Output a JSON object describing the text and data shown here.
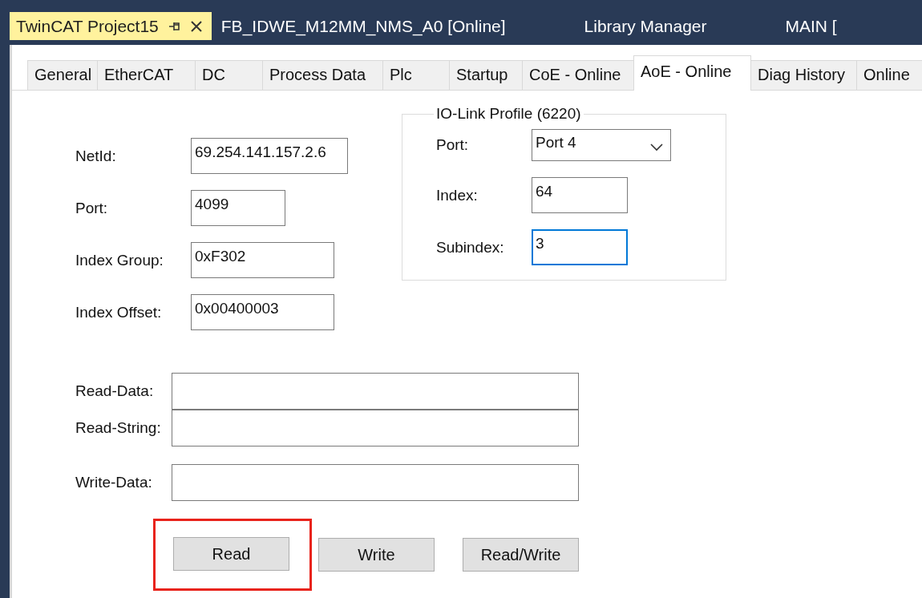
{
  "document_tabs": [
    {
      "label": "TwinCAT Project15",
      "selected": true
    },
    {
      "label": "FB_IDWE_M12MM_NMS_A0 [Online]",
      "selected": false
    },
    {
      "label": "Library Manager",
      "selected": false
    },
    {
      "label": "MAIN [",
      "selected": false
    }
  ],
  "tabs": [
    {
      "label": "General",
      "selected": false
    },
    {
      "label": "EtherCAT",
      "selected": false
    },
    {
      "label": "DC",
      "selected": false
    },
    {
      "label": "Process Data",
      "selected": false
    },
    {
      "label": "Plc",
      "selected": false
    },
    {
      "label": "Startup",
      "selected": false
    },
    {
      "label": "CoE - Online",
      "selected": false
    },
    {
      "label": "AoE - Online",
      "selected": true
    },
    {
      "label": "Diag History",
      "selected": false
    },
    {
      "label": "Online",
      "selected": false
    }
  ],
  "connection_fields": [
    {
      "label": "NetId:",
      "value": "69.254.141.157.2.6"
    },
    {
      "label": "Port:",
      "value": "4099"
    },
    {
      "label": "Index Group:",
      "value": "0xF302"
    },
    {
      "label": "Index Offset:",
      "value": "0x00400003"
    }
  ],
  "io_link_profile": {
    "title": "IO-Link Profile (6220)",
    "fields": [
      {
        "kind": "dropdown",
        "label": "Port:",
        "value": "Port 4",
        "focused": false
      },
      {
        "kind": "text",
        "label": "Index:",
        "value": "64",
        "focused": false
      },
      {
        "kind": "text",
        "label": "Subindex:",
        "value": "3",
        "focused": true
      }
    ]
  },
  "data_fields": [
    {
      "label": "Read-Data:"
    },
    {
      "label": "Read-String:"
    },
    {
      "label": "Write-Data:"
    }
  ],
  "buttons": [
    {
      "label": "Read",
      "highlighted": true
    },
    {
      "label": "Write",
      "highlighted": false
    },
    {
      "label": "Read/Write",
      "highlighted": false
    }
  ]
}
